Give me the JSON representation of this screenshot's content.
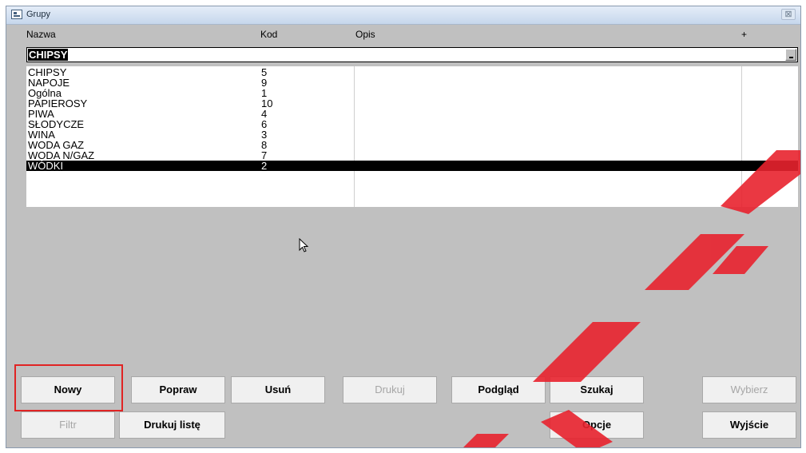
{
  "window": {
    "title": "Grupy",
    "close_label": "⊠"
  },
  "columns": {
    "name": "Nazwa",
    "code": "Kod",
    "description": "Opis",
    "extra": "+"
  },
  "search": {
    "value": "CHIPSY"
  },
  "rows": [
    {
      "name": "CHIPSY",
      "code": "5"
    },
    {
      "name": "NAPOJE",
      "code": "9"
    },
    {
      "name": "Ogólna",
      "code": "1"
    },
    {
      "name": "PAPIEROSY",
      "code": "10"
    },
    {
      "name": "PIWA",
      "code": "4"
    },
    {
      "name": "SŁODYCZE",
      "code": "6"
    },
    {
      "name": "WINA",
      "code": "3"
    },
    {
      "name": "WODA GAZ",
      "code": "8"
    },
    {
      "name": "WODA N/GAZ",
      "code": "7"
    },
    {
      "name": "WÓDKI",
      "code": "2",
      "selected": true
    }
  ],
  "buttons": {
    "new": "Nowy",
    "edit": "Popraw",
    "delete": "Usuń",
    "print": "Drukuj",
    "preview": "Podgląd",
    "search": "Szukaj",
    "select": "Wybierz",
    "filter": "Filtr",
    "print_list": "Drukuj listę",
    "options": "Opcje",
    "exit": "Wyjście"
  },
  "colors": {
    "highlight": "#e02424",
    "selection": "#000000",
    "watermark": "#e8222e"
  }
}
